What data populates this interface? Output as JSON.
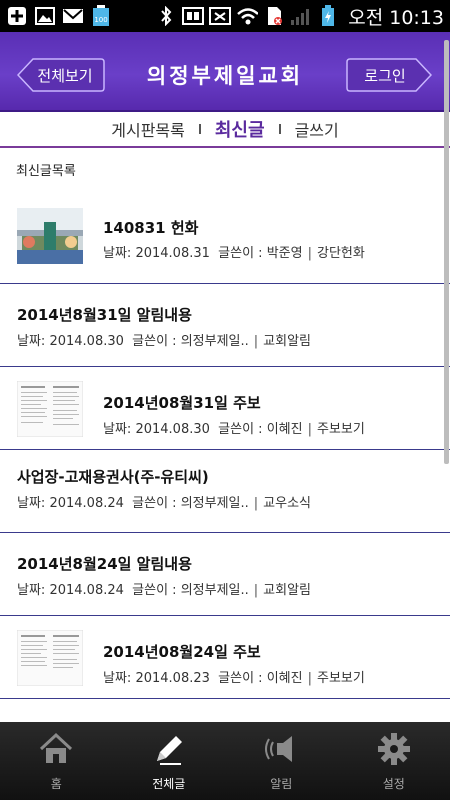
{
  "status_bar": {
    "time": "오전 10:13",
    "icons": [
      "plus-icon",
      "image-icon",
      "gmail-icon",
      "battery-100-icon",
      "bluetooth-icon",
      "nfc-icon",
      "silent-icon",
      "wifi-icon",
      "sim-icon",
      "signal-icon",
      "charging-icon"
    ],
    "battery_label": "100"
  },
  "header": {
    "back_label": "전체보기",
    "title": "의정부제일교회",
    "login_label": "로그인",
    "accent": "#6a3fc8"
  },
  "tabs": [
    {
      "label": "게시판목록",
      "active": false
    },
    {
      "label": "최신글",
      "active": true
    },
    {
      "label": "글쓰기",
      "active": false
    }
  ],
  "list": {
    "heading": "최신글목록",
    "items": [
      {
        "title": "140831 헌화",
        "date_label": "날짜:",
        "date": "2014.08.31",
        "author_label": "글쓴이 :",
        "author": "박준영",
        "category": "강단헌화",
        "thumbnail": "altar-photo"
      },
      {
        "title": "2014년8월31일 알림내용",
        "date_label": "날짜:",
        "date": "2014.08.30",
        "author_label": "글쓴이 :",
        "author": "의정부제일..",
        "category": "교회알림",
        "thumbnail": null
      },
      {
        "title": "2014년08월31일 주보",
        "date_label": "날짜:",
        "date": "2014.08.30",
        "author_label": "글쓴이 :",
        "author": "이혜진",
        "category": "주보보기",
        "thumbnail": "bulletin-doc"
      },
      {
        "title": "사업장-고재용권사(주-유티씨)",
        "date_label": "날짜:",
        "date": "2014.08.24",
        "author_label": "글쓴이 :",
        "author": "의정부제일..",
        "category": "교우소식",
        "thumbnail": null
      },
      {
        "title": "2014년8월24일 알림내용",
        "date_label": "날짜:",
        "date": "2014.08.24",
        "author_label": "글쓴이 :",
        "author": "의정부제일..",
        "category": "교회알림",
        "thumbnail": null
      },
      {
        "title": "2014년08월24일 주보",
        "date_label": "날짜:",
        "date": "2014.08.23",
        "author_label": "글쓴이 :",
        "author": "이혜진",
        "category": "주보보기",
        "thumbnail": "bulletin-doc"
      }
    ]
  },
  "bottom_nav": [
    {
      "label": "홈",
      "icon": "home-icon",
      "active": false
    },
    {
      "label": "전체글",
      "icon": "pencil-icon",
      "active": true
    },
    {
      "label": "알림",
      "icon": "speaker-icon",
      "active": false
    },
    {
      "label": "설정",
      "icon": "gear-icon",
      "active": false
    }
  ]
}
